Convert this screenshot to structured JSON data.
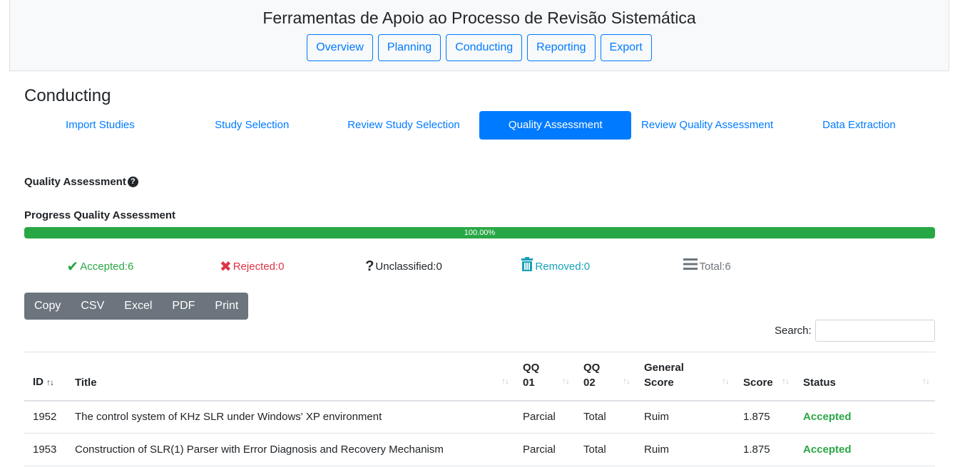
{
  "header": {
    "title": "Ferramentas de Apoio ao Processo de Revisão Sistemática",
    "nav": [
      "Overview",
      "Planning",
      "Conducting",
      "Reporting",
      "Export"
    ]
  },
  "page": {
    "heading": "Conducting",
    "tabs": [
      "Import Studies",
      "Study Selection",
      "Review Study Selection",
      "Quality Assessment",
      "Review Quality Assessment",
      "Data Extraction"
    ],
    "active_tab": "Quality Assessment"
  },
  "section": {
    "title": "Quality Assessment",
    "progress_label": "Progress Quality Assessment",
    "progress_text": "100.00%",
    "progress_value": 100
  },
  "stats": [
    {
      "label": "Accepted:",
      "value": "6",
      "icon": "check-icon",
      "color": "#28a745"
    },
    {
      "label": "Rejected:",
      "value": "0",
      "icon": "x-icon",
      "color": "#dc3545"
    },
    {
      "label": "Unclassified:",
      "value": "0",
      "icon": "question-icon",
      "color": "#212529"
    },
    {
      "label": "Removed:",
      "value": "0",
      "icon": "trash-icon",
      "color": "#17a2b8"
    },
    {
      "label": "Total:",
      "value": "6",
      "icon": "list-icon",
      "color": "#6c757d"
    }
  ],
  "export_buttons": [
    "Copy",
    "CSV",
    "Excel",
    "PDF",
    "Print"
  ],
  "search": {
    "label": "Search:",
    "value": ""
  },
  "table": {
    "columns": [
      "ID",
      "Title",
      "QQ 01",
      "QQ 02",
      "General Score",
      "Score",
      "Status"
    ],
    "rows": [
      {
        "id": "1952",
        "title": "The control system of KHz SLR under Windows' XP environment",
        "qq01": "Parcial",
        "qq02": "Total",
        "general": "Ruim",
        "score": "1.875",
        "status": "Accepted"
      },
      {
        "id": "1953",
        "title": "Construction of SLR(1) Parser with Error Diagnosis and Recovery Mechanism",
        "qq01": "Parcial",
        "qq02": "Total",
        "general": "Ruim",
        "score": "1.875",
        "status": "Accepted"
      }
    ]
  }
}
